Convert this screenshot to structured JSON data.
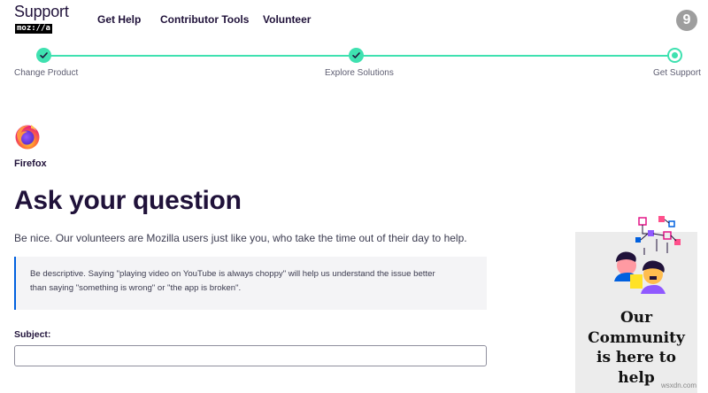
{
  "header": {
    "logo_title": "Support",
    "logo_sub": "moz://a",
    "nav": [
      "Get Help",
      "Contributor Tools",
      "Volunteer"
    ],
    "avatar_initial": "9"
  },
  "steps": [
    {
      "label": "Change Product",
      "state": "done"
    },
    {
      "label": "Explore Solutions",
      "state": "done"
    },
    {
      "label": "Get Support",
      "state": "current"
    }
  ],
  "product": {
    "name": "Firefox",
    "icon": "firefox-logo"
  },
  "page_title": "Ask your question",
  "intro": "Be nice. Our volunteers are Mozilla users just like you, who take the time out of their day to help.",
  "note": {
    "line1": "Be descriptive. Saying \"playing video on YouTube is always choppy\" will help us understand the issue better",
    "line2": "than saying \"something is wrong\" or \"the app is broken\"."
  },
  "form": {
    "subject_label": "Subject:",
    "subject_value": ""
  },
  "community_card": {
    "lines": [
      "Our",
      "Community",
      "is here to",
      "help"
    ]
  },
  "watermark": "wsxdn.com",
  "colors": {
    "accent": "#3fe1b0",
    "text": "#20123a",
    "note_border": "#0060df"
  }
}
